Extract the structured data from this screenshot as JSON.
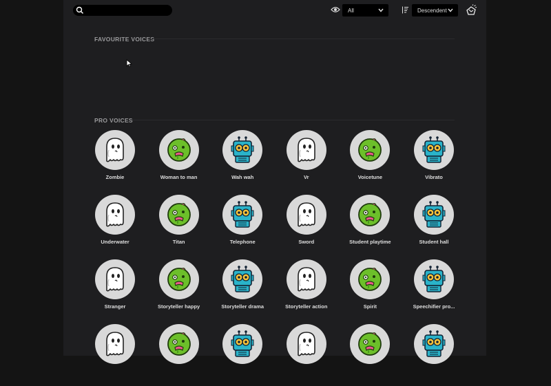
{
  "topbar": {
    "search_placeholder": "",
    "filter_value": "All",
    "sort_value": "Descendent"
  },
  "sections": {
    "favourites_title": "FAVOURITE VOICES",
    "pro_title": "PRO VOICES"
  },
  "voices": [
    {
      "name": "Zombie",
      "icon": "ghost-icon"
    },
    {
      "name": "Woman to man",
      "icon": "zombie-icon"
    },
    {
      "name": "Wah wah",
      "icon": "robot-icon"
    },
    {
      "name": "Vr",
      "icon": "ghost-icon"
    },
    {
      "name": "Voicetune",
      "icon": "zombie-icon"
    },
    {
      "name": "Vibrato",
      "icon": "robot-icon"
    },
    {
      "name": "Underwater",
      "icon": "ghost-icon"
    },
    {
      "name": "Titan",
      "icon": "zombie-icon"
    },
    {
      "name": "Telephone",
      "icon": "robot-icon"
    },
    {
      "name": "Sword",
      "icon": "ghost-icon"
    },
    {
      "name": "Student playtime",
      "icon": "zombie-icon"
    },
    {
      "name": "Student hall",
      "icon": "robot-icon"
    },
    {
      "name": "Stranger",
      "icon": "ghost-icon"
    },
    {
      "name": "Storyteller happy",
      "icon": "zombie-icon"
    },
    {
      "name": "Storyteller drama",
      "icon": "robot-icon"
    },
    {
      "name": "Storyteller action",
      "icon": "ghost-icon"
    },
    {
      "name": "Spirit",
      "icon": "zombie-icon"
    },
    {
      "name": "Speechifier pro...",
      "icon": "robot-icon"
    },
    {
      "name": "",
      "icon": "ghost-icon"
    },
    {
      "name": "",
      "icon": "zombie-icon"
    },
    {
      "name": "",
      "icon": "robot-icon"
    },
    {
      "name": "",
      "icon": "ghost-icon"
    },
    {
      "name": "",
      "icon": "zombie-icon"
    },
    {
      "name": "",
      "icon": "robot-icon"
    }
  ],
  "colors": {
    "background": "#141414",
    "panel": "#1e1e20",
    "tile": "#d9d9d9",
    "zombie_green": "#6cbf2a",
    "robot_teal": "#2ab3c9",
    "accent_pink": "#e8588a"
  }
}
